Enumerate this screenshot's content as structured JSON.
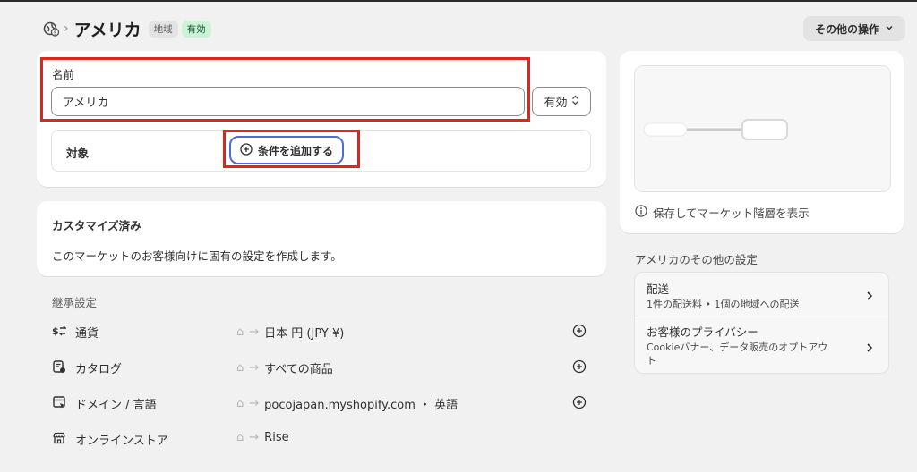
{
  "header": {
    "title": "アメリカ",
    "badge_region": "地域",
    "badge_status": "有効",
    "more_actions": "その他の操作"
  },
  "name_section": {
    "label": "名前",
    "value": "アメリカ",
    "status_select": "有効"
  },
  "target_section": {
    "label": "対象",
    "add_condition": "条件を追加する"
  },
  "customized": {
    "title": "カスタマイズ済み",
    "description": "このマーケットのお客様向けに固有の設定を作成します。"
  },
  "inherited": {
    "heading": "継承設定",
    "rows": [
      {
        "label": "通貨",
        "value": "日本 円 (JPY ¥)",
        "icon": "currency-exchange-icon"
      },
      {
        "label": "カタログ",
        "value": "すべての商品",
        "icon": "catalog-icon"
      },
      {
        "label": "ドメイン / 言語",
        "value": "pocojapan.myshopify.com ・ 英語",
        "icon": "domain-icon"
      },
      {
        "label": "オンラインストア",
        "value": "Rise",
        "icon": "online-store-icon"
      }
    ]
  },
  "preview": {
    "info_text": "保存してマーケット階層を表示"
  },
  "other_settings": {
    "heading": "アメリカのその他の設定",
    "items": [
      {
        "title": "配送",
        "subtitle": "1件の配送料 • 1個の地域への配送"
      },
      {
        "title": "お客様のプライバシー",
        "subtitle_line1": "Cookieバナー、データ販売のオプトアウ",
        "subtitle_line2": "ト"
      }
    ]
  },
  "colors": {
    "highlight": "#e2251b",
    "focus_ring": "#4a6ce0",
    "badge_green": "#cdf2d6",
    "background": "#f1f1f1"
  }
}
